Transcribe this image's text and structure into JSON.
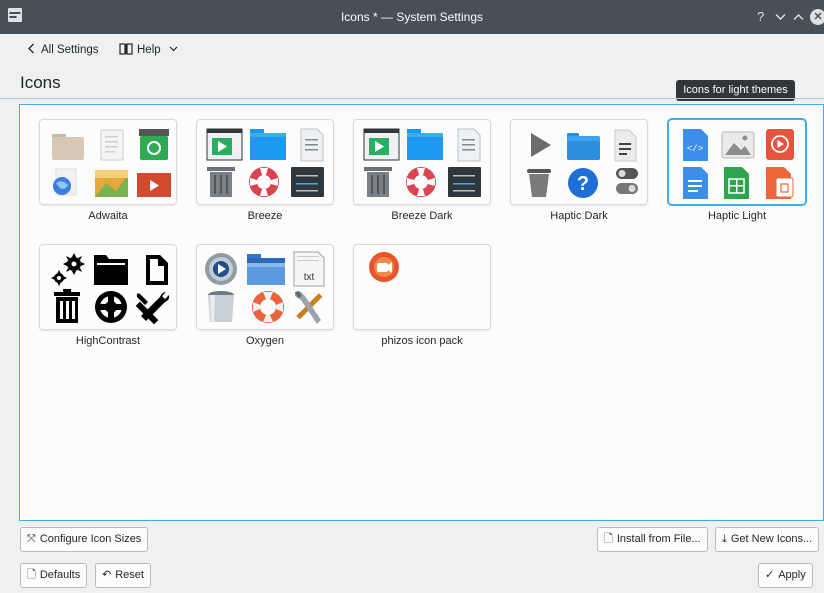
{
  "window": {
    "title": "Icons * — System Settings",
    "help_glyph": "?"
  },
  "nav": {
    "back_label": "All Settings",
    "help_label": "Help"
  },
  "page": {
    "title": "Icons"
  },
  "tooltip": {
    "text": "Icons for light themes"
  },
  "themes": [
    {
      "name": "Adwaita"
    },
    {
      "name": "Breeze"
    },
    {
      "name": "Breeze Dark"
    },
    {
      "name": "Haptic Dark"
    },
    {
      "name": "Haptic Light",
      "selected": true
    },
    {
      "name": "HighContrast"
    },
    {
      "name": "Oxygen"
    },
    {
      "name": "phizos icon pack"
    }
  ],
  "oxygen_txt_label": "txt",
  "buttons": {
    "configure_sizes": "Configure Icon Sizes",
    "install_from_file": "Install from File...",
    "get_new_icons": "Get New Icons...",
    "defaults": "Defaults",
    "reset": "Reset",
    "apply": "Apply"
  },
  "colors": {
    "accent": "#3daee9",
    "titlebar": "#475057"
  }
}
